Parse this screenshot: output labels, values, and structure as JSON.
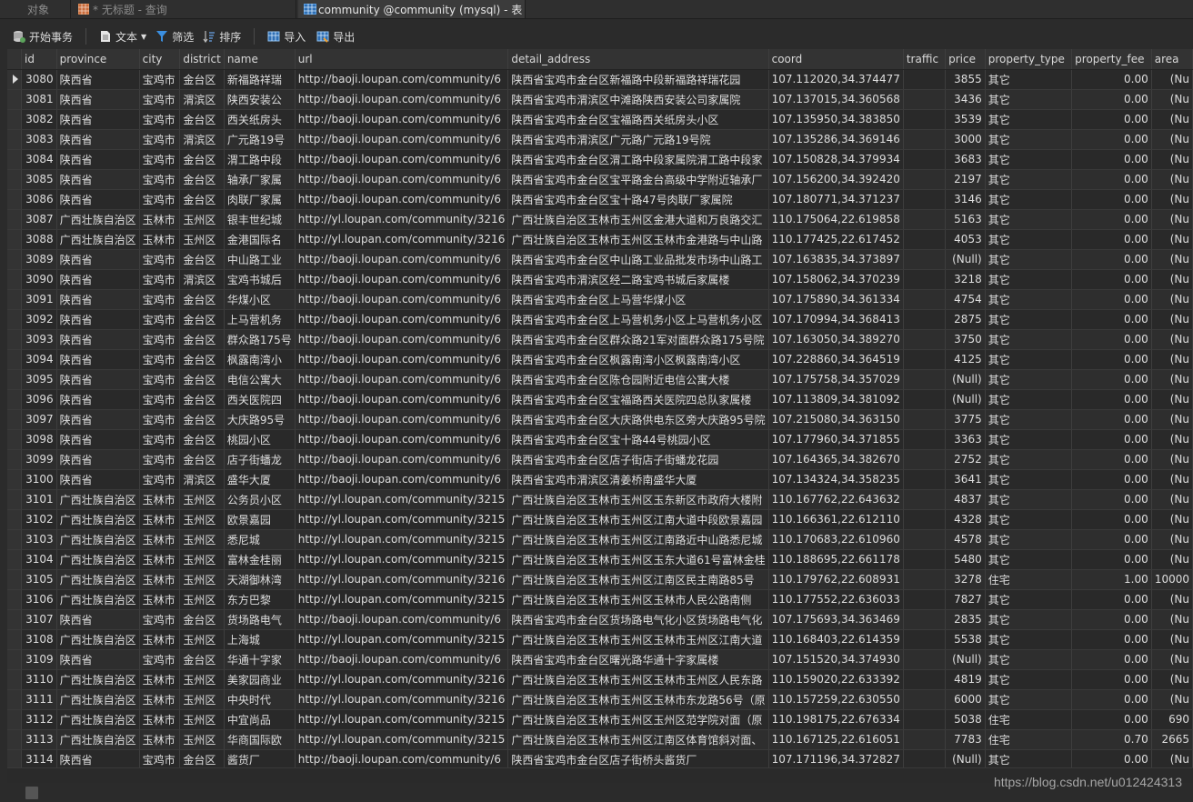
{
  "tabs": [
    {
      "label": "对象",
      "active": false
    },
    {
      "label": "* 无标题 - 查询",
      "active": false
    },
    {
      "label": "community @community (mysql) - 表",
      "active": true
    }
  ],
  "toolbar": {
    "begin_transaction": "开始事务",
    "text": "文本",
    "filter": "筛选",
    "sort": "排序",
    "import": "导入",
    "export": "导出"
  },
  "columns": [
    "id",
    "province",
    "city",
    "district",
    "name",
    "url",
    "detail_address",
    "coord",
    "traffic",
    "price",
    "property_type",
    "property_fee",
    "area"
  ],
  "rows": [
    [
      "3080",
      "陕西省",
      "宝鸡市",
      "金台区",
      "新福路祥瑞",
      "http://baoji.loupan.com/community/6",
      "陕西省宝鸡市金台区新福路中段新福路祥瑞花园",
      "107.112020,34.374477",
      "",
      "3855",
      "其它",
      "0.00",
      "(Nu"
    ],
    [
      "3081",
      "陕西省",
      "宝鸡市",
      "渭滨区",
      "陕西安装公",
      "http://baoji.loupan.com/community/6",
      "陕西省宝鸡市渭滨区中滩路陕西安装公司家属院",
      "107.137015,34.360568",
      "",
      "3436",
      "其它",
      "0.00",
      "(Nu"
    ],
    [
      "3082",
      "陕西省",
      "宝鸡市",
      "金台区",
      "西关纸房头",
      "http://baoji.loupan.com/community/6",
      "陕西省宝鸡市金台区宝福路西关纸房头小区",
      "107.135950,34.383850",
      "",
      "3539",
      "其它",
      "0.00",
      "(Nu"
    ],
    [
      "3083",
      "陕西省",
      "宝鸡市",
      "渭滨区",
      "广元路19号",
      "http://baoji.loupan.com/community/6",
      "陕西省宝鸡市渭滨区广元路广元路19号院",
      "107.135286,34.369146",
      "",
      "3000",
      "其它",
      "0.00",
      "(Nu"
    ],
    [
      "3084",
      "陕西省",
      "宝鸡市",
      "金台区",
      "渭工路中段",
      "http://baoji.loupan.com/community/6",
      "陕西省宝鸡市金台区渭工路中段家属院渭工路中段家",
      "107.150828,34.379934",
      "",
      "3683",
      "其它",
      "0.00",
      "(Nu"
    ],
    [
      "3085",
      "陕西省",
      "宝鸡市",
      "金台区",
      "轴承厂家属",
      "http://baoji.loupan.com/community/6",
      "陕西省宝鸡市金台区宝平路金台高级中学附近轴承厂",
      "107.156200,34.392420",
      "",
      "2197",
      "其它",
      "0.00",
      "(Nu"
    ],
    [
      "3086",
      "陕西省",
      "宝鸡市",
      "金台区",
      "肉联厂家属",
      "http://baoji.loupan.com/community/6",
      "陕西省宝鸡市金台区宝十路47号肉联厂家属院",
      "107.180771,34.371237",
      "",
      "3146",
      "其它",
      "0.00",
      "(Nu"
    ],
    [
      "3087",
      "广西壮族自治区",
      "玉林市",
      "玉州区",
      "银丰世纪城",
      "http://yl.loupan.com/community/3216",
      "广西壮族自治区玉林市玉州区金港大道和万良路交汇",
      "110.175064,22.619858",
      "",
      "5163",
      "其它",
      "0.00",
      "(Nu"
    ],
    [
      "3088",
      "广西壮族自治区",
      "玉林市",
      "玉州区",
      "金港国际名",
      "http://yl.loupan.com/community/3216",
      "广西壮族自治区玉林市玉州区玉林市金港路与中山路",
      "110.177425,22.617452",
      "",
      "4053",
      "其它",
      "0.00",
      "(Nu"
    ],
    [
      "3089",
      "陕西省",
      "宝鸡市",
      "金台区",
      "中山路工业",
      "http://baoji.loupan.com/community/6",
      "陕西省宝鸡市金台区中山路工业品批发市场中山路工",
      "107.163835,34.373897",
      "",
      "(Null)",
      "其它",
      "0.00",
      "(Nu"
    ],
    [
      "3090",
      "陕西省",
      "宝鸡市",
      "渭滨区",
      "宝鸡书城后",
      "http://baoji.loupan.com/community/6",
      "陕西省宝鸡市渭滨区经二路宝鸡书城后家属楼",
      "107.158062,34.370239",
      "",
      "3218",
      "其它",
      "0.00",
      "(Nu"
    ],
    [
      "3091",
      "陕西省",
      "宝鸡市",
      "金台区",
      "华煤小区",
      "http://baoji.loupan.com/community/6",
      "陕西省宝鸡市金台区上马营华煤小区",
      "107.175890,34.361334",
      "",
      "4754",
      "其它",
      "0.00",
      "(Nu"
    ],
    [
      "3092",
      "陕西省",
      "宝鸡市",
      "金台区",
      "上马营机务",
      "http://baoji.loupan.com/community/6",
      "陕西省宝鸡市金台区上马营机务小区上马营机务小区",
      "107.170994,34.368413",
      "",
      "2875",
      "其它",
      "0.00",
      "(Nu"
    ],
    [
      "3093",
      "陕西省",
      "宝鸡市",
      "金台区",
      "群众路175号",
      "http://baoji.loupan.com/community/6",
      "陕西省宝鸡市金台区群众路21军对面群众路175号院",
      "107.163050,34.389270",
      "",
      "3750",
      "其它",
      "0.00",
      "(Nu"
    ],
    [
      "3094",
      "陕西省",
      "宝鸡市",
      "金台区",
      "枫露南湾小",
      "http://baoji.loupan.com/community/6",
      "陕西省宝鸡市金台区枫露南湾小区枫露南湾小区",
      "107.228860,34.364519",
      "",
      "4125",
      "其它",
      "0.00",
      "(Nu"
    ],
    [
      "3095",
      "陕西省",
      "宝鸡市",
      "金台区",
      "电信公寓大",
      "http://baoji.loupan.com/community/6",
      "陕西省宝鸡市金台区陈仓园附近电信公寓大楼",
      "107.175758,34.357029",
      "",
      "(Null)",
      "其它",
      "0.00",
      "(Nu"
    ],
    [
      "3096",
      "陕西省",
      "宝鸡市",
      "金台区",
      "西关医院四",
      "http://baoji.loupan.com/community/6",
      "陕西省宝鸡市金台区宝福路西关医院四总队家属楼",
      "107.113809,34.381092",
      "",
      "(Null)",
      "其它",
      "0.00",
      "(Nu"
    ],
    [
      "3097",
      "陕西省",
      "宝鸡市",
      "金台区",
      "大庆路95号",
      "http://baoji.loupan.com/community/6",
      "陕西省宝鸡市金台区大庆路供电东区旁大庆路95号院",
      "107.215080,34.363150",
      "",
      "3775",
      "其它",
      "0.00",
      "(Nu"
    ],
    [
      "3098",
      "陕西省",
      "宝鸡市",
      "金台区",
      "桃园小区",
      "http://baoji.loupan.com/community/6",
      "陕西省宝鸡市金台区宝十路44号桃园小区",
      "107.177960,34.371855",
      "",
      "3363",
      "其它",
      "0.00",
      "(Nu"
    ],
    [
      "3099",
      "陕西省",
      "宝鸡市",
      "金台区",
      "店子街蟠龙",
      "http://baoji.loupan.com/community/6",
      "陕西省宝鸡市金台区店子街店子街蟠龙花园",
      "107.164365,34.382670",
      "",
      "2752",
      "其它",
      "0.00",
      "(Nu"
    ],
    [
      "3100",
      "陕西省",
      "宝鸡市",
      "渭滨区",
      "盛华大厦",
      "http://baoji.loupan.com/community/6",
      "陕西省宝鸡市渭滨区清姜桥南盛华大厦",
      "107.134324,34.358235",
      "",
      "3641",
      "其它",
      "0.00",
      "(Nu"
    ],
    [
      "3101",
      "广西壮族自治区",
      "玉林市",
      "玉州区",
      "公务员小区",
      "http://yl.loupan.com/community/3215",
      "广西壮族自治区玉林市玉州区玉东新区市政府大楼附",
      "110.167762,22.643632",
      "",
      "4837",
      "其它",
      "0.00",
      "(Nu"
    ],
    [
      "3102",
      "广西壮族自治区",
      "玉林市",
      "玉州区",
      "欧景嘉园",
      "http://yl.loupan.com/community/3215",
      "广西壮族自治区玉林市玉州区江南大道中段欧景嘉园",
      "110.166361,22.612110",
      "",
      "4328",
      "其它",
      "0.00",
      "(Nu"
    ],
    [
      "3103",
      "广西壮族自治区",
      "玉林市",
      "玉州区",
      "悉尼城",
      "http://yl.loupan.com/community/3215",
      "广西壮族自治区玉林市玉州区江南路近中山路悉尼城",
      "110.170683,22.610960",
      "",
      "4578",
      "其它",
      "0.00",
      "(Nu"
    ],
    [
      "3104",
      "广西壮族自治区",
      "玉林市",
      "玉州区",
      "富林金桂丽",
      "http://yl.loupan.com/community/3215",
      "广西壮族自治区玉林市玉州区玉东大道61号富林金桂",
      "110.188695,22.661178",
      "",
      "5480",
      "其它",
      "0.00",
      "(Nu"
    ],
    [
      "3105",
      "广西壮族自治区",
      "玉林市",
      "玉州区",
      "天湖御林湾",
      "http://yl.loupan.com/community/3216",
      "广西壮族自治区玉林市玉州区江南区民主南路85号",
      "110.179762,22.608931",
      "",
      "3278",
      "住宅",
      "1.00",
      "10000"
    ],
    [
      "3106",
      "广西壮族自治区",
      "玉林市",
      "玉州区",
      "东方巴黎",
      "http://yl.loupan.com/community/3215",
      "广西壮族自治区玉林市玉州区玉林市人民公路南侧",
      "110.177552,22.636033",
      "",
      "7827",
      "其它",
      "0.00",
      "(Nu"
    ],
    [
      "3107",
      "陕西省",
      "宝鸡市",
      "金台区",
      "货场路电气",
      "http://baoji.loupan.com/community/6",
      "陕西省宝鸡市金台区货场路电气化小区货场路电气化",
      "107.175693,34.363469",
      "",
      "2835",
      "其它",
      "0.00",
      "(Nu"
    ],
    [
      "3108",
      "广西壮族自治区",
      "玉林市",
      "玉州区",
      "上海城",
      "http://yl.loupan.com/community/3215",
      "广西壮族自治区玉林市玉州区玉林市玉州区江南大道",
      "110.168403,22.614359",
      "",
      "5538",
      "其它",
      "0.00",
      "(Nu"
    ],
    [
      "3109",
      "陕西省",
      "宝鸡市",
      "金台区",
      "华通十字家",
      "http://baoji.loupan.com/community/6",
      "陕西省宝鸡市金台区曙光路华通十字家属楼",
      "107.151520,34.374930",
      "",
      "(Null)",
      "其它",
      "0.00",
      "(Nu"
    ],
    [
      "3110",
      "广西壮族自治区",
      "玉林市",
      "玉州区",
      "美家园商业",
      "http://yl.loupan.com/community/3216",
      "广西壮族自治区玉林市玉州区玉林市玉州区人民东路",
      "110.159020,22.633392",
      "",
      "4819",
      "其它",
      "0.00",
      "(Nu"
    ],
    [
      "3111",
      "广西壮族自治区",
      "玉林市",
      "玉州区",
      "中央时代",
      "http://yl.loupan.com/community/3216",
      "广西壮族自治区玉林市玉州区玉林市东龙路56号（原",
      "110.157259,22.630550",
      "",
      "6000",
      "其它",
      "0.00",
      "(Nu"
    ],
    [
      "3112",
      "广西壮族自治区",
      "玉林市",
      "玉州区",
      "中宜尚品",
      "http://yl.loupan.com/community/3215",
      "广西壮族自治区玉林市玉州区玉州区范学院对面（原",
      "110.198175,22.676334",
      "",
      "5038",
      "住宅",
      "0.00",
      "690"
    ],
    [
      "3113",
      "广西壮族自治区",
      "玉林市",
      "玉州区",
      "华商国际欧",
      "http://yl.loupan.com/community/3215",
      "广西壮族自治区玉林市玉州区江南区体育馆斜对面、",
      "110.167125,22.616051",
      "",
      "7783",
      "住宅",
      "0.70",
      "2665"
    ],
    [
      "3114",
      "陕西省",
      "宝鸡市",
      "金台区",
      "酱货厂",
      "http://baoji.loupan.com/community/6",
      "陕西省宝鸡市金台区店子街桥头酱货厂",
      "107.171196,34.372827",
      "",
      "(Null)",
      "其它",
      "0.00",
      "(Nu"
    ]
  ],
  "watermark": "https://blog.csdn.net/u012424313",
  "colors": {
    "bg": "#2b2b2b",
    "header": "#333333",
    "text": "#dedede",
    "null": "#6e6e6e"
  }
}
